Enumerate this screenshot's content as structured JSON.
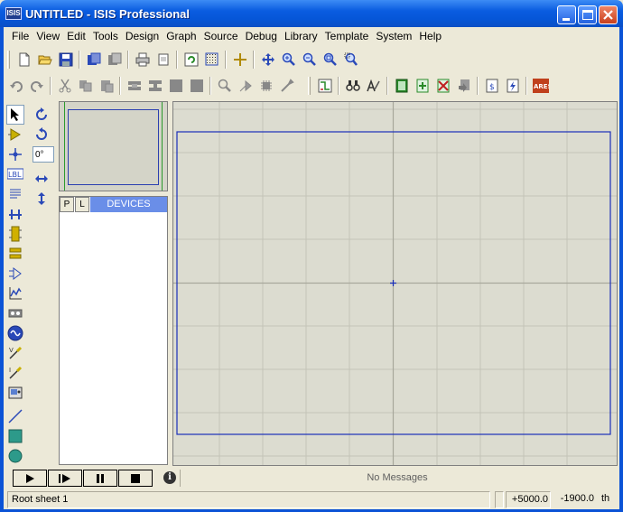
{
  "window": {
    "app_icon": "ISIS",
    "title": "UNTITLED - ISIS Professional",
    "controls": [
      "minimize-icon",
      "maximize-icon",
      "close-icon"
    ]
  },
  "menu": [
    "File",
    "View",
    "Edit",
    "Tools",
    "Design",
    "Graph",
    "Source",
    "Debug",
    "Library",
    "Template",
    "System",
    "Help"
  ],
  "toolbar1": [
    "new-file-icon",
    "open-folder-icon",
    "save-icon",
    "import-section-icon",
    "export-section-icon",
    "print-icon",
    "print-area-icon",
    "refresh-icon",
    "grid-icon",
    "origin-icon",
    "pan-icon",
    "zoom-in-icon",
    "zoom-out-icon",
    "zoom-all-icon",
    "zoom-area-icon"
  ],
  "toolbar2": [
    "undo-icon",
    "redo-icon",
    "cut-icon",
    "copy-icon",
    "paste-icon",
    "block-copy-icon",
    "block-move-icon",
    "block-rotate-icon",
    "block-delete-icon",
    "pick-device-icon",
    "make-device-icon",
    "packaging-icon",
    "decompose-icon",
    "wire-autorouter-icon",
    "search-tag-icon",
    "property-assign-icon",
    "new-sheet-icon",
    "add-sheet-icon",
    "remove-sheet-icon",
    "goto-sheet-icon",
    "bom-icon",
    "erc-icon",
    "ares-icon"
  ],
  "ares_label": "ARES",
  "mode_tools": [
    "selection-mode-icon",
    "component-mode-icon",
    "junction-dot-icon",
    "wire-label-icon",
    "text-script-icon",
    "buses-icon",
    "subcircuit-icon",
    "terminals-icon",
    "device-pins-icon",
    "graph-mode-icon",
    "tape-recorder-icon",
    "generator-icon",
    "voltage-probe-icon",
    "current-probe-icon",
    "virtual-instruments-icon",
    "line-icon",
    "box-icon",
    "circle-icon"
  ],
  "lbl_text": "LBL",
  "rotation": {
    "angle": "0°",
    "tools": [
      "rotate-clockwise-icon",
      "rotate-anticlockwise-icon",
      "mirror-x-icon",
      "mirror-y-icon"
    ]
  },
  "devices": {
    "p_button": "P",
    "l_button": "L",
    "title": "DEVICES"
  },
  "sim_controls": [
    "play-icon",
    "step-icon",
    "pause-icon",
    "stop-icon"
  ],
  "messages": "No Messages",
  "status": {
    "sheet": "Root sheet 1",
    "coord_x": "+5000.0",
    "coord_y": "-1900.0",
    "units": "th"
  },
  "colors": {
    "titlebar": "#0a5ce0",
    "sheet_border": "#1a2fb8",
    "canvas": "#dcdcd0",
    "devices_header": "#6a8ee8"
  }
}
